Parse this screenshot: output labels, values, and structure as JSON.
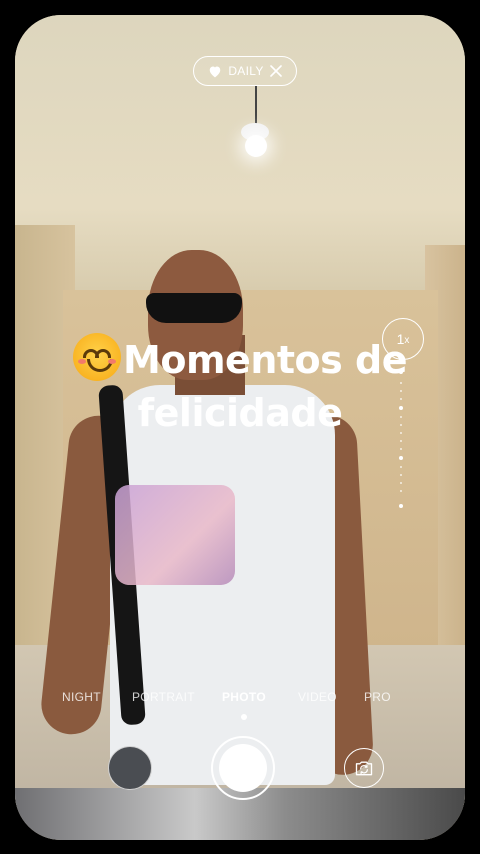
{
  "top_pill": {
    "label": "DAILY",
    "heart_icon": "heart-icon",
    "close_icon": "close-icon"
  },
  "caption": {
    "line1": "Momentos de",
    "line2": "felicidade",
    "emoji": "smiling-face-emoji"
  },
  "zoom": {
    "value": "1",
    "unit": "x"
  },
  "modes": [
    {
      "label": "NIGHT",
      "active": false
    },
    {
      "label": "PORTRAIT",
      "active": false
    },
    {
      "label": "PHOTO",
      "active": true
    },
    {
      "label": "VIDEO",
      "active": false
    },
    {
      "label": "PRO",
      "active": false
    }
  ],
  "controls": {
    "gallery_icon": "gallery-thumbnail",
    "shutter_icon": "shutter-button",
    "flip_icon": "flip-camera-icon"
  }
}
